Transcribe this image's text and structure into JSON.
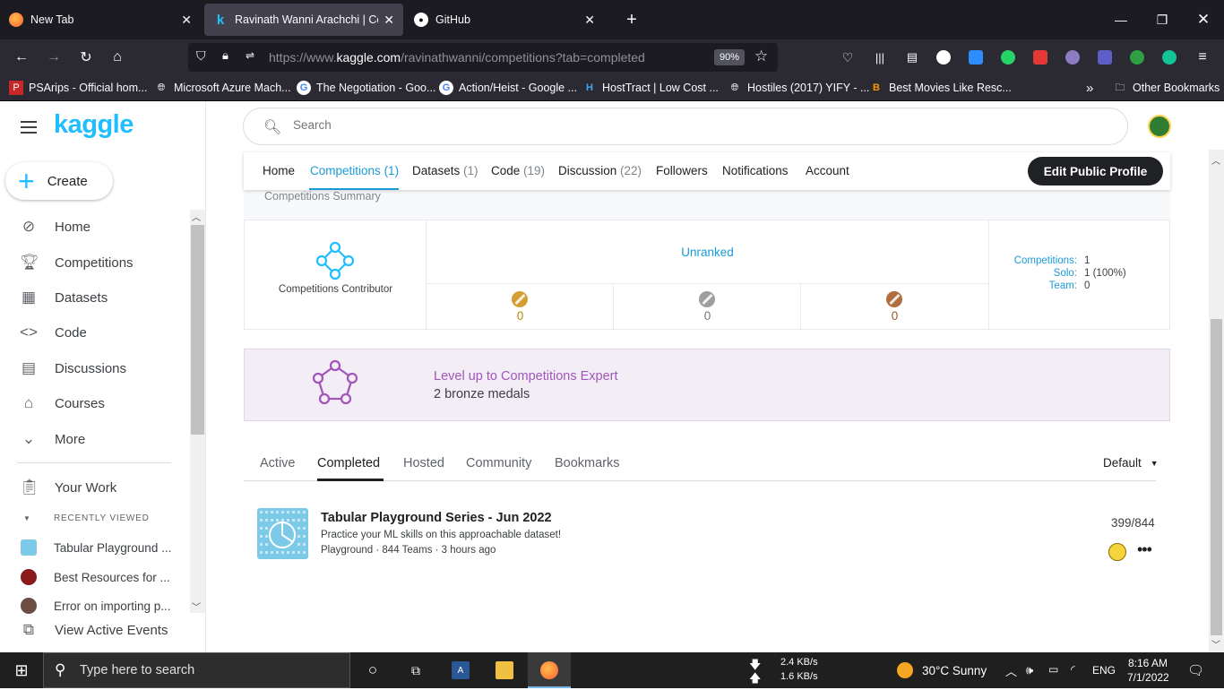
{
  "browser": {
    "tabs": [
      {
        "label": "New Tab",
        "active": false
      },
      {
        "label": "Ravinath Wanni Arachchi | Cont",
        "active": true
      },
      {
        "label": "GitHub",
        "active": false
      }
    ],
    "url_prefix": "https://www.",
    "url_host": "kaggle.com",
    "url_path": "/ravinathwanni/competitions?tab=completed",
    "zoom": "90%",
    "bookmarks": [
      "PSArips - Official hom...",
      "Microsoft Azure Mach...",
      "The Negotiation - Goo...",
      "Action/Heist - Google ...",
      "HostTract | Low Cost ...",
      "Hostiles (2017) YIFY - ...",
      "Best Movies Like Resc..."
    ],
    "other_bookmarks": "Other Bookmarks"
  },
  "sidebar": {
    "logo": "kaggle",
    "create_label": "Create",
    "items": [
      {
        "label": "Home",
        "icon": "compass-icon"
      },
      {
        "label": "Competitions",
        "icon": "trophy-icon"
      },
      {
        "label": "Datasets",
        "icon": "table-icon"
      },
      {
        "label": "Code",
        "icon": "code-icon"
      },
      {
        "label": "Discussions",
        "icon": "discussion-icon"
      },
      {
        "label": "Courses",
        "icon": "school-icon"
      },
      {
        "label": "More",
        "icon": "chevron-down-icon"
      }
    ],
    "your_work": "Your Work",
    "recently_viewed_label": "RECENTLY VIEWED",
    "recent": [
      "Tabular Playground ...",
      "Best Resources for ...",
      "Error on importing p..."
    ],
    "view_active_events": "View Active Events"
  },
  "search": {
    "placeholder": "Search"
  },
  "profile_nav": {
    "items": [
      {
        "label": "Home",
        "count": ""
      },
      {
        "label": "Competitions",
        "count": "(1)"
      },
      {
        "label": "Datasets",
        "count": "(1)"
      },
      {
        "label": "Code",
        "count": "(19)"
      },
      {
        "label": "Discussion",
        "count": "(22)"
      },
      {
        "label": "Followers",
        "count": ""
      },
      {
        "label": "Notifications",
        "count": ""
      },
      {
        "label": "Account",
        "count": ""
      }
    ],
    "edit_button": "Edit Public Profile"
  },
  "summary": {
    "header": "Competitions Summary",
    "tier": "Competitions Contributor",
    "rank": "Unranked",
    "medals": {
      "gold": "0",
      "silver": "0",
      "bronze": "0"
    },
    "stats": [
      {
        "key": "Competitions:",
        "value": "1"
      },
      {
        "key": "Solo:",
        "value": "1 (100%)"
      },
      {
        "key": "Team:",
        "value": "0"
      }
    ],
    "colors": {
      "gold": "#d39f34",
      "silver": "#9e9e9e",
      "bronze": "#b06d3e"
    }
  },
  "levelup": {
    "title": "Level up to Competitions Expert",
    "subtitle": "2 bronze medals"
  },
  "comp_tabs": [
    "Active",
    "Completed",
    "Hosted",
    "Community",
    "Bookmarks"
  ],
  "sort": "Default",
  "competition": {
    "title": "Tabular Playground Series - Jun 2022",
    "description": "Practice your ML skills on this approachable dataset!",
    "meta": "Playground · 844 Teams · 3 hours ago",
    "rank": "399/844"
  },
  "taskbar": {
    "search_placeholder": "Type here to search",
    "net_down": "2.4 KB/s",
    "net_up": "1.6 KB/s",
    "weather": "30°C  Sunny",
    "lang": "ENG",
    "time": "8:16 AM",
    "date": "7/1/2022"
  }
}
